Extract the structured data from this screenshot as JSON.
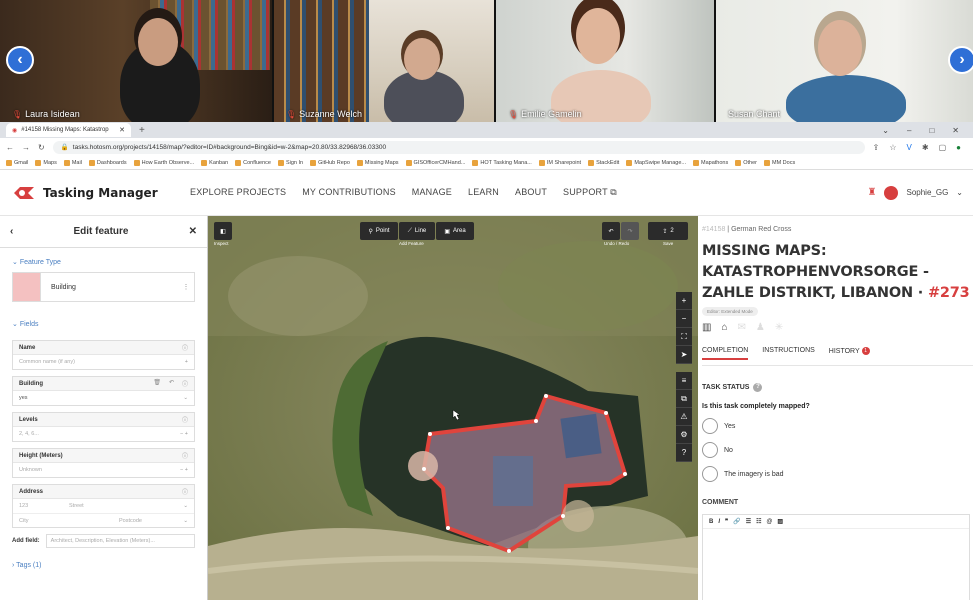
{
  "participants": [
    {
      "name": "Laura Isidean"
    },
    {
      "name": "Suzanne Welch"
    },
    {
      "name": "Emilie Gamelin"
    },
    {
      "name": "Susan Chant"
    }
  ],
  "browser": {
    "tab_title": "#14158 Missing Maps: Katastrop",
    "url": "tasks.hotosm.org/projects/14158/map/?editor=ID#background=Bing&id=w-2&map=20.80/33.82968/36.03300",
    "bookmarks": [
      "Gmail",
      "Maps",
      "Mail",
      "Dashboards",
      "How Earth Observe...",
      "Kanban",
      "Confluence",
      "Sign In",
      "GitHub Repo",
      "Missing Maps",
      "GISOfficerCMHand...",
      "HOT Tasking Mana...",
      "IM Sharepoint",
      "StackEdit",
      "MapSwipe Manage...",
      "Mapathons",
      "Other",
      "MM Docs"
    ]
  },
  "app": {
    "logo_text": "Tasking Manager",
    "nav": [
      "EXPLORE PROJECTS",
      "MY CONTRIBUTIONS",
      "MANAGE",
      "LEARN",
      "ABOUT",
      "SUPPORT ⧉"
    ],
    "username": "Sophie_GG"
  },
  "editor": {
    "title": "Edit feature",
    "feature_type_label": "Feature Type",
    "feature_type_value": "Building",
    "fields_label": "Fields",
    "fields": [
      {
        "label": "Name",
        "placeholder": "Common name (if any)"
      },
      {
        "label": "Building",
        "placeholder": "yes"
      },
      {
        "label": "Levels",
        "placeholder": "2, 4, 6..."
      },
      {
        "label": "Height (Meters)",
        "placeholder": "Unknown"
      },
      {
        "label": "Address",
        "placeholder": ""
      }
    ],
    "address_parts": [
      "123",
      "Street",
      "City",
      "Postcode"
    ],
    "add_field_label": "Add field:",
    "add_field_placeholder": "Architect, Description, Elevation (Meters)...",
    "tags_label": "Tags (1)"
  },
  "map": {
    "inspect": "Inspect",
    "point": "Point",
    "line": "Line",
    "area": "Area",
    "add_feature": "Add Feature",
    "undo_redo": "Undo / Redo",
    "save": "Save",
    "save_count": "2"
  },
  "task": {
    "project_id": "#14158",
    "org": "German Red Cross",
    "title_main": "MISSING MAPS: KATASTROPHENVORSORGE - ZAHLE DISTRIKT, LIBANON",
    "title_task": "#273",
    "badge": "Editor: Extended Mode",
    "tabs": [
      "COMPLETION",
      "INSTRUCTIONS",
      "HISTORY"
    ],
    "history_count": "1",
    "status_heading": "TASK STATUS",
    "question": "Is this task completely mapped?",
    "options": [
      "Yes",
      "No",
      "The imagery is bad"
    ],
    "comment_heading": "COMMENT"
  }
}
